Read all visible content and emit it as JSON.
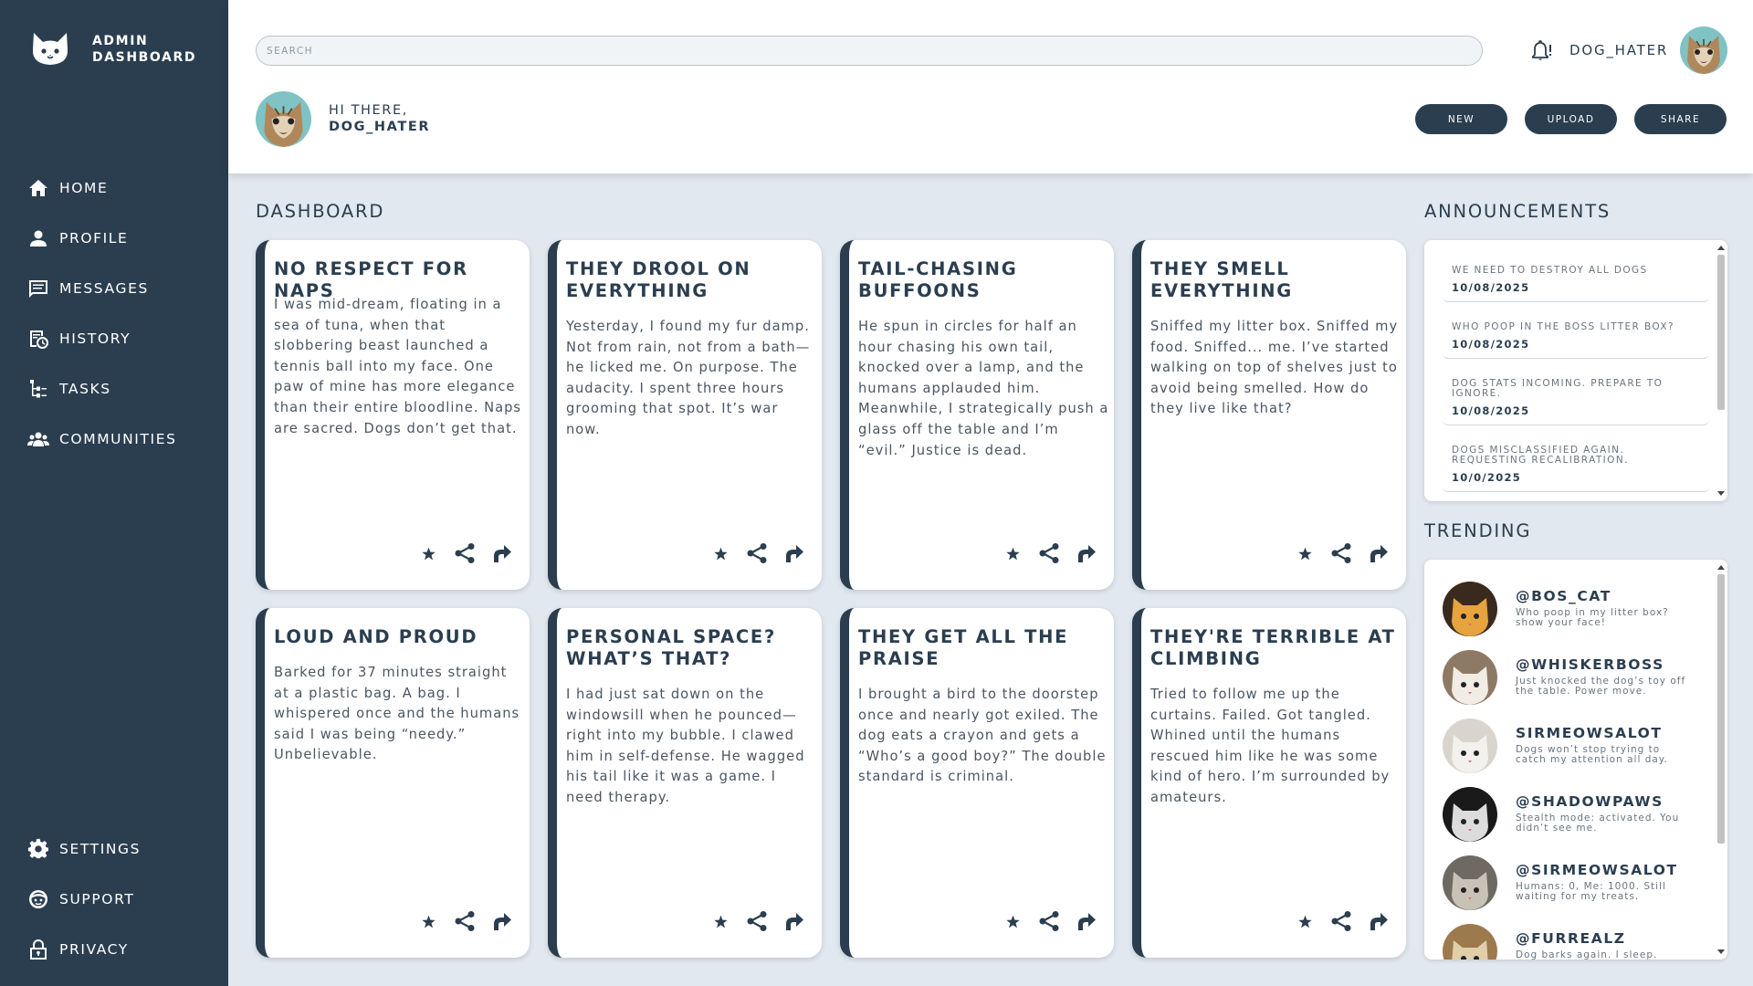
{
  "brand": {
    "line1": "ADMIN",
    "line2": "DASHBOARD",
    "logo_icon": "cat-face-icon"
  },
  "nav": [
    {
      "label": "HOME",
      "icon": "home-icon"
    },
    {
      "label": "PROFILE",
      "icon": "user-icon"
    },
    {
      "label": "MESSAGES",
      "icon": "message-icon"
    },
    {
      "label": "HISTORY",
      "icon": "history-icon"
    },
    {
      "label": "TASKS",
      "icon": "tasks-icon"
    },
    {
      "label": "COMMUNITIES",
      "icon": "communities-icon"
    }
  ],
  "nav_bottom": [
    {
      "label": "SETTINGS",
      "icon": "gear-icon"
    },
    {
      "label": "SUPPORT",
      "icon": "support-icon"
    },
    {
      "label": "PRIVACY",
      "icon": "lock-icon"
    }
  ],
  "header": {
    "search_placeholder": "SEARCH",
    "username": "DOG_HATER",
    "greeting": "HI THERE,",
    "greeting_name": "DOG_HATER",
    "buttons": [
      "NEW",
      "UPLOAD",
      "SHARE"
    ]
  },
  "dashboard": {
    "title": "DASHBOARD",
    "cards": [
      {
        "title": "NO RESPECT FOR NAPS",
        "body": "I was mid-dream, floating in a sea of tuna, when that slobbering beast launched a tennis ball into my face. One paw of mine has more elegance than their entire bloodline. Naps are sacred. Dogs don’t get that."
      },
      {
        "title": "THEY DROOL ON EVERYTHING",
        "body": "Yesterday, I found my fur damp. Not from rain, not from a bath—he licked me. On purpose. The audacity. I spent three hours grooming that spot. It’s war now."
      },
      {
        "title": "TAIL-CHASING BUFFOONS",
        "body": "He spun in circles for half an hour chasing his own tail, knocked over a lamp, and the humans applauded him. Meanwhile, I strategically push a glass off the table and I’m “evil.” Justice is dead."
      },
      {
        "title": "THEY SMELL EVERYTHING",
        "body": "Sniffed my litter box. Sniffed my food. Sniffed... me. I’ve started walking on top of shelves just to avoid being smelled. How do they live like that?"
      },
      {
        "title": "LOUD AND PROUD",
        "body": "Barked for 37 minutes straight at a plastic bag. A bag. I whispered once and the humans said I was being “needy.” Unbelievable."
      },
      {
        "title": "PERSONAL SPACE? WHAT’S THAT?",
        "body": "I had just sat down on the windowsill when he pounced—right into my bubble. I clawed him in self-defense. He wagged his tail like it was a game. I need therapy."
      },
      {
        "title": "THEY GET ALL THE PRAISE",
        "body": "I brought a bird to the doorstep once and nearly got exiled. The dog eats a crayon and gets a “Who’s a good boy?” The double standard is criminal."
      },
      {
        "title": "THEY'RE TERRIBLE AT CLIMBING",
        "body": "Tried to follow me up the curtains. Failed. Got tangled. Whined until the humans rescued him like he was some kind of hero. I’m surrounded by amateurs."
      }
    ]
  },
  "announcements": {
    "title": "ANNOUNCEMENTS",
    "items": [
      {
        "text": "WE NEED TO DESTROY ALL DOGS",
        "date": "10/08/2025"
      },
      {
        "text": "WHO POOP IN THE BOSS LITTER BOX?",
        "date": "10/08/2025"
      },
      {
        "text": "DOG STATS INCOMING. PREPARE TO IGNORE.",
        "date": "10/08/2025"
      },
      {
        "text": "DOGS MISCLASSIFIED AGAIN. REQUESTING RECALIBRATION.",
        "date": "10/0/2025"
      }
    ]
  },
  "trending": {
    "title": "TRENDING",
    "items": [
      {
        "name": "@BOS_CAT",
        "desc": "Who poop in my litter box? show your face!"
      },
      {
        "name": "@WHISKERBOSS",
        "desc": "Just knocked the dog’s toy off the table. Power move."
      },
      {
        "name": "SIRMEOWSALOT",
        "desc": "Dogs won’t stop trying to catch my attention all day."
      },
      {
        "name": "@SHADOWPAWS",
        "desc": "Stealth mode: activated. You didn’t see me."
      },
      {
        "name": "@SIRMEOWSALOT",
        "desc": "Humans: 0, Me: 1000. Still waiting for my treats."
      },
      {
        "name": "@FURREALZ",
        "desc": "Dog barks again. I sleep."
      }
    ]
  },
  "colors": {
    "primary": "#2b3e50",
    "background": "#e2e8f0",
    "panel": "#ffffff"
  }
}
